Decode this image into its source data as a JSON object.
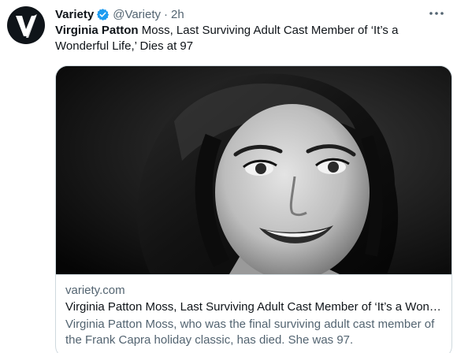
{
  "account": {
    "display_name": "Variety",
    "handle": "@Variety",
    "separator": "·",
    "time": "2h",
    "avatar_letter": "V",
    "verified_color": "#1d9bf0"
  },
  "tweet": {
    "name_bold": "Virginia Patton",
    "text_rest": " Moss, Last Surviving Adult Cast Member of ‘It’s a Wonderful Life,’ Dies at 97"
  },
  "card": {
    "domain": "variety.com",
    "title": "Virginia Patton Moss, Last Surviving Adult Cast Member of ‘It’s a Won…",
    "description": "Virginia Patton Moss, who was the final surviving adult cast member of the Frank Capra holiday classic, has died. She was 97."
  },
  "icons": {
    "avatar": "variety-v-logo-icon",
    "verified": "verified-badge-icon",
    "more": "more-options-icon"
  }
}
